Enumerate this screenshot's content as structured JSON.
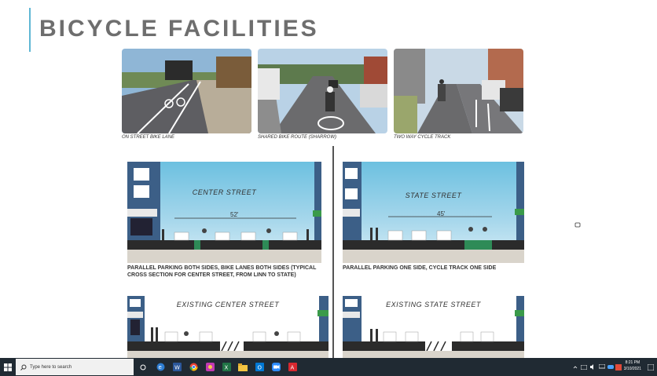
{
  "slide": {
    "title": "BICYCLE FACILITIES",
    "photos": [
      {
        "caption": "ON STREET BIKE LANE"
      },
      {
        "caption": "SHARED BIKE ROUTE (SHARROW)"
      },
      {
        "caption": "TWO WAY CYCLE TRACK"
      }
    ],
    "sections": [
      {
        "title": "CENTER STREET",
        "width": "52'",
        "description": "PARALLEL PARKING BOTH SIDES, BIKE LANES BOTH SIDES (TYPICAL CROSS SECTION FOR CENTER STREET, FROM LINN TO STATE)"
      },
      {
        "title": "STATE STREET",
        "width": "45'",
        "description": "PARALLEL PARKING ONE SIDE, CYCLE TRACK ONE SIDE"
      },
      {
        "title": "EXISTING CENTER STREET"
      },
      {
        "title": "EXISTING STATE STREET"
      }
    ]
  },
  "taskbar": {
    "search_placeholder": "Type here to search",
    "time": "8:21 PM",
    "date": "3/10/2021"
  },
  "colors": {
    "accent": "#5fb7d4",
    "title": "#6e6e6e",
    "taskbar": "#202a33",
    "bike_lane": "#2e8b57"
  }
}
